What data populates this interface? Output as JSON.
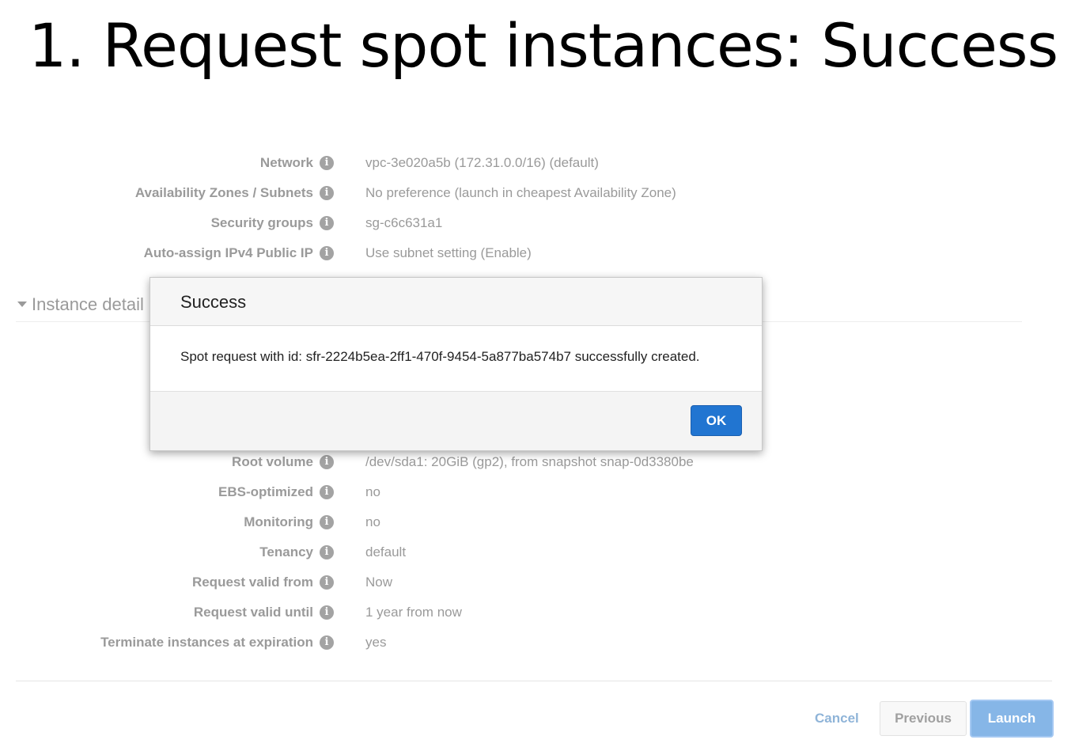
{
  "slide": {
    "title": "1.  Request spot instances: Success"
  },
  "network_details": [
    {
      "label": "Network",
      "value": "vpc-3e020a5b (172.31.0.0/16) (default)"
    },
    {
      "label": "Availability Zones / Subnets",
      "value": "No preference (launch in cheapest Availability Zone)"
    },
    {
      "label": "Security groups",
      "value": "sg-c6c631a1"
    },
    {
      "label": "Auto-assign IPv4 Public IP",
      "value": "Use subnet setting (Enable)"
    }
  ],
  "instance_section": {
    "label": "Instance detail"
  },
  "instance_details": [
    {
      "label": "Root volume",
      "value": "/dev/sda1: 20GiB (gp2), from snapshot snap-0d3380be"
    },
    {
      "label": "EBS-optimized",
      "value": "no"
    },
    {
      "label": "Monitoring",
      "value": "no"
    },
    {
      "label": "Tenancy",
      "value": "default"
    },
    {
      "label": "Request valid from",
      "value": "Now"
    },
    {
      "label": "Request valid until",
      "value": "1 year from now"
    },
    {
      "label": "Terminate instances at expiration",
      "value": "yes"
    }
  ],
  "info_icon_glyph": "i",
  "footer": {
    "cancel_label": "Cancel",
    "previous_label": "Previous",
    "launch_label": "Launch"
  },
  "modal": {
    "title": "Success",
    "message": "Spot request with id: sfr-2224b5ea-2ff1-470f-9454-5a877ba574b7 successfully created.",
    "ok_label": "OK"
  },
  "colors": {
    "ok_button": "#2175d1",
    "launch_button": "#86b6e7",
    "cancel_link": "#8fb4d8",
    "muted_text": "#9a9a9a"
  }
}
